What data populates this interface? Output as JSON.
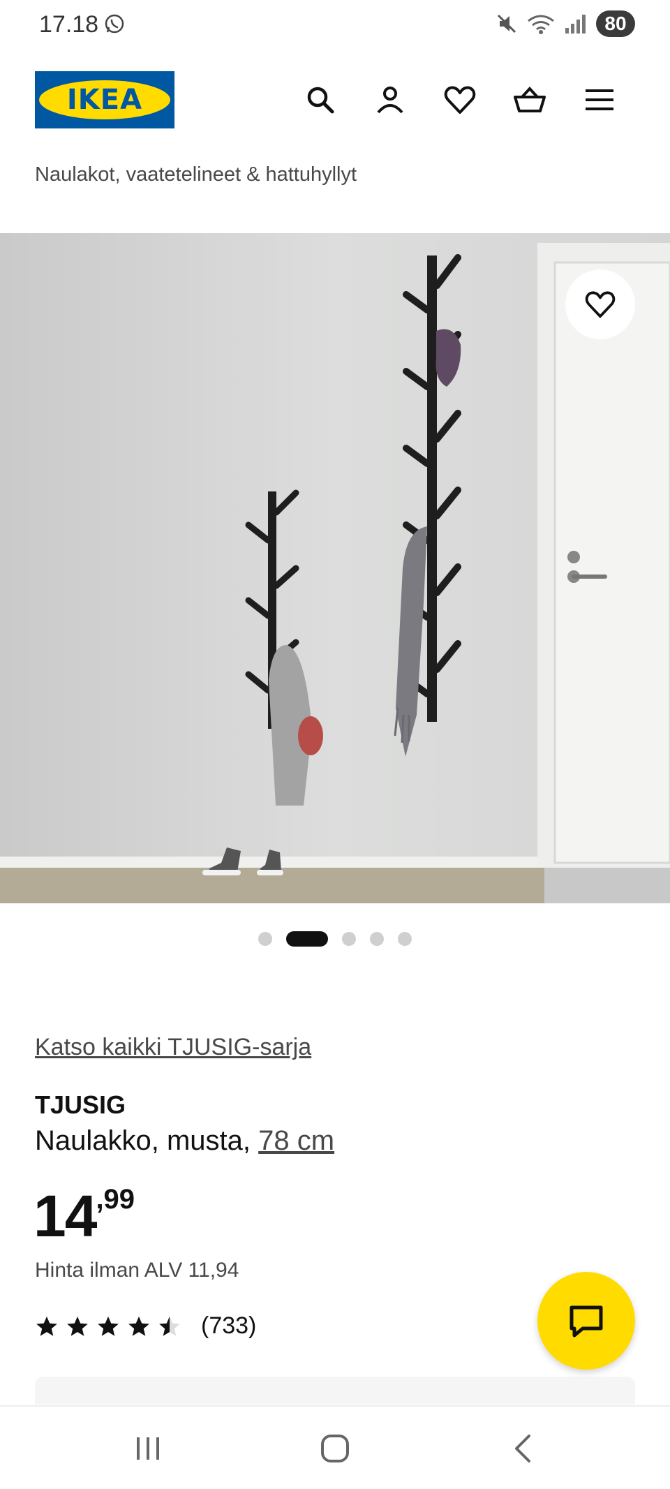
{
  "status": {
    "time": "17.18",
    "battery": "80"
  },
  "header": {
    "logo_text": "IKEA",
    "brand_colors": {
      "blue": "#0058a3",
      "yellow": "#ffdb00"
    },
    "icons": [
      "search-icon",
      "account-icon",
      "wishlist-icon",
      "basket-icon",
      "menu-icon"
    ]
  },
  "breadcrumb": "Naulakot, vaatetelineet & hattuhyllyt",
  "gallery": {
    "dot_count": 5,
    "active_index": 1
  },
  "product": {
    "series_link": "Katso kaikki TJUSIG-sarja",
    "name": "TJUSIG",
    "description": "Naulakko, musta, ",
    "size_link": "78 cm",
    "price_integer": "14",
    "price_decimal": ",99",
    "vat_text": "Hinta ilman ALV 11,94",
    "rating": 4.5,
    "rating_max": 5,
    "rating_count": "(733)"
  },
  "chat": {
    "icon": "chat-icon",
    "color": "#ffdb00"
  },
  "navbar": {
    "icons": [
      "recent-apps-icon",
      "home-icon",
      "back-icon"
    ]
  }
}
